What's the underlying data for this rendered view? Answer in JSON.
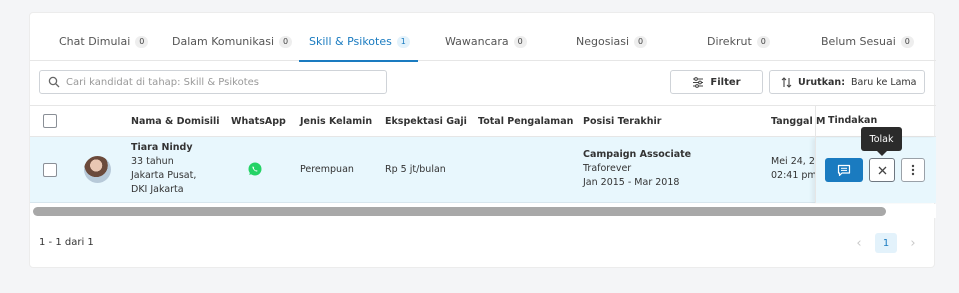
{
  "tabs": [
    {
      "label": "Chat Dimulai",
      "count": "0"
    },
    {
      "label": "Dalam Komunikasi",
      "count": "0"
    },
    {
      "label": "Skill & Psikotes",
      "count": "1"
    },
    {
      "label": "Wawancara",
      "count": "0"
    },
    {
      "label": "Negosiasi",
      "count": "0"
    },
    {
      "label": "Direkrut",
      "count": "0"
    },
    {
      "label": "Belum Sesuai",
      "count": "0"
    }
  ],
  "search": {
    "placeholder": "Cari kandidat di tahap: Skill & Psikotes",
    "value": ""
  },
  "toolbar": {
    "filter_label": "Filter",
    "sort_label": "Urutkan:",
    "sort_value": "Baru ke Lama"
  },
  "table": {
    "columns": {
      "name": "Nama & Domisili",
      "whatsapp": "WhatsApp",
      "gender": "Jenis Kelamin",
      "salary": "Ekspektasi Gaji",
      "experience": "Total Pengalaman",
      "position": "Posisi Terakhir",
      "date": "Tanggal M",
      "actions": "Tindakan"
    },
    "rows": [
      {
        "name": "Tiara Nindy",
        "age": "33 tahun",
        "city": "Jakarta Pusat,",
        "province": "DKI Jakarta",
        "gender": "Perempuan",
        "salary": "Rp 5 jt/bulan",
        "experience": "",
        "position_title": "Campaign Associate",
        "company": "Traforever",
        "period": "Jan 2015 - Mar 2018",
        "date": "Mei 24, 2",
        "time": "02:41 pm"
      }
    ]
  },
  "tooltip": {
    "text": "Tolak"
  },
  "pagination": {
    "summary": "1 - 1 dari 1",
    "current_page": "1"
  },
  "colors": {
    "accent": "#1a7bc0",
    "row_highlight": "#e8f7fd",
    "whatsapp": "#25d366"
  }
}
